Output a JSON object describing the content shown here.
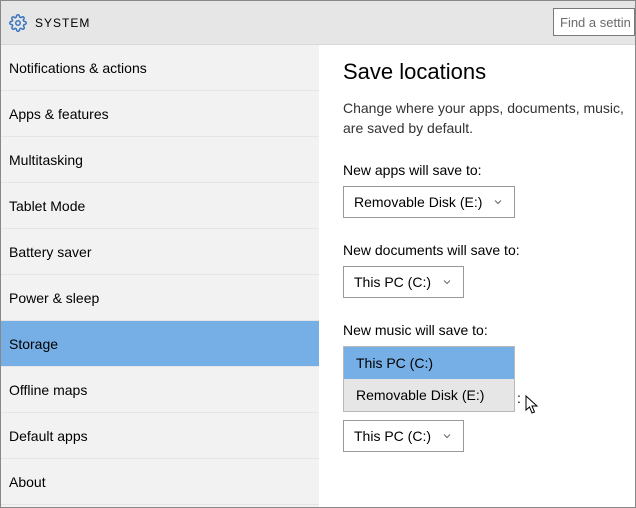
{
  "header": {
    "title": "SYSTEM",
    "search_placeholder": "Find a settin"
  },
  "sidebar": {
    "items": [
      {
        "label": "Notifications & actions",
        "selected": false
      },
      {
        "label": "Apps & features",
        "selected": false
      },
      {
        "label": "Multitasking",
        "selected": false
      },
      {
        "label": "Tablet Mode",
        "selected": false
      },
      {
        "label": "Battery saver",
        "selected": false
      },
      {
        "label": "Power & sleep",
        "selected": false
      },
      {
        "label": "Storage",
        "selected": true
      },
      {
        "label": "Offline maps",
        "selected": false
      },
      {
        "label": "Default apps",
        "selected": false
      },
      {
        "label": "About",
        "selected": false
      }
    ]
  },
  "panel": {
    "heading": "Save locations",
    "description_line1": "Change where your apps, documents, music,",
    "description_line2": "are saved by default.",
    "settings": {
      "apps": {
        "label": "New apps will save to:",
        "value": "Removable Disk (E:)"
      },
      "documents": {
        "label": "New documents will save to:",
        "value": "This PC (C:)"
      },
      "music": {
        "label": "New music will save to:",
        "dropdown_open": true,
        "options": [
          "This PC (C:)",
          "Removable Disk (E:)"
        ],
        "selected": "This PC (C:)",
        "partial_suffix": ":"
      },
      "next": {
        "value": "This PC (C:)"
      }
    }
  }
}
